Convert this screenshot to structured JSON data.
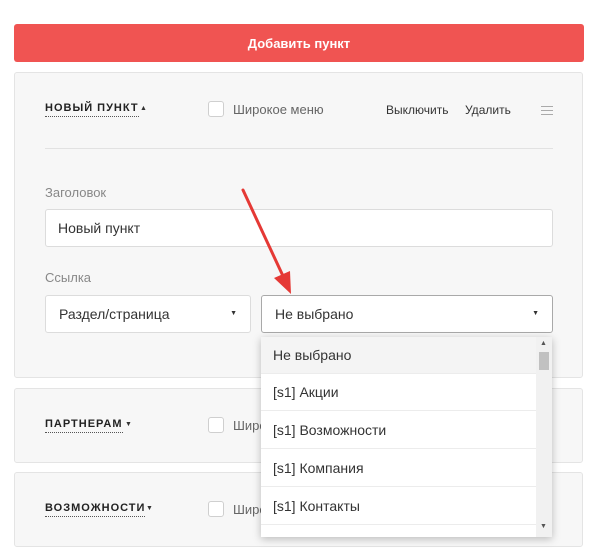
{
  "add_button": "Добавить пункт",
  "items": [
    {
      "title": "НОВЫЙ ПУНКТ",
      "wide_menu": "Широкое меню",
      "disable": "Выключить",
      "delete": "Удалить"
    },
    {
      "title": "ПАРТНЕРАМ",
      "wide_menu": "Широ"
    },
    {
      "title": "ВОЗМОЖНОСТИ",
      "wide_menu": "Широ"
    }
  ],
  "form": {
    "heading_label": "Заголовок",
    "heading_value": "Новый пункт",
    "link_label": "Ссылка",
    "link_type": "Раздел/страница",
    "link_target": "Не выбрано"
  },
  "dropdown_options": [
    "Не выбрано",
    "[s1] Акции",
    "[s1] Возможности",
    "[s1] Компания",
    "[s1] Контакты"
  ],
  "colors": {
    "accent": "#f05452",
    "arrow": "#e53935"
  }
}
